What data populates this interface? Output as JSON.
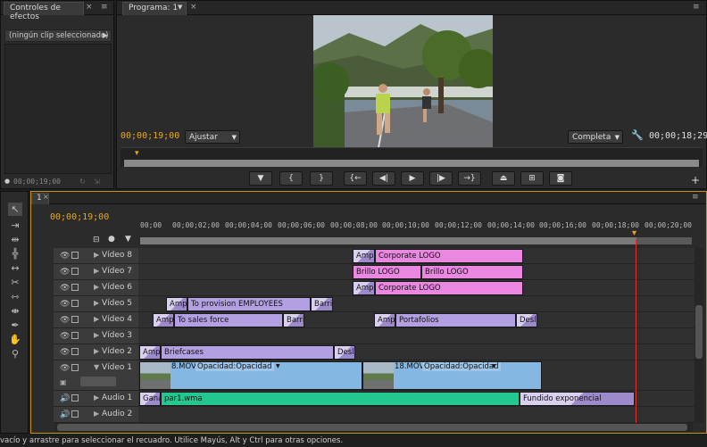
{
  "effects": {
    "tab_label": "Controles de efectos",
    "no_clip": "(ningún clip seleccionado)",
    "timecode": "00;00;19;00"
  },
  "program": {
    "tab_label": "Programa: 1",
    "timecode_current": "00;00;19;00",
    "fit_select": "Ajustar",
    "quality_select": "Completa",
    "timecode_duration": "00;00;18;29"
  },
  "timeline": {
    "tab_label": "1",
    "timecode": "00;00;19;00",
    "ruler": [
      "00;00",
      "00;00;02;00",
      "00;00;04;00",
      "00;00;06;00",
      "00;00;08;00",
      "00;00;10;00",
      "00;00;12;00",
      "00;00;14;00",
      "00;00;16;00",
      "00;00;18;00",
      "00;00;20;00"
    ],
    "tracks": [
      {
        "name": "Vídeo 8"
      },
      {
        "name": "Vídeo 7"
      },
      {
        "name": "Vídeo 6"
      },
      {
        "name": "Vídeo 5"
      },
      {
        "name": "Vídeo 4"
      },
      {
        "name": "Vídeo 3"
      },
      {
        "name": "Vídeo 2"
      },
      {
        "name": "Vídeo 1"
      },
      {
        "name": "Audio 1"
      },
      {
        "name": "Audio 2"
      }
    ],
    "clips": {
      "v8_a": "Ampli",
      "v8_b": "Corporate LOGO",
      "v7_a": "Brillo LOGO",
      "v7_b": "Brillo LOGO",
      "v6_a": "Ampli",
      "v6_b": "Corporate LOGO",
      "v5_a": "Ampli",
      "v5_b": "To provision EMPLOYEES",
      "v5_c": "Barric",
      "v4_a": "Ampli",
      "v4_b": "To sales force",
      "v4_c": "Barri",
      "v4_d": "Ampli",
      "v4_e": "Portafolios",
      "v4_f": "Desli",
      "v2_a": "Ampli",
      "v2_b": "Briefcases",
      "v2_c": "Desliz",
      "v1_a": "8.MOV",
      "v1_a_fx": "Opacidad:Opacidad",
      "v1_b": "18.MOV",
      "v1_b_fx": "Opacidad:Opacidad",
      "a1_a": "Gana",
      "a1_b": "par1.wma",
      "a1_c": "Fundido exponencial"
    }
  },
  "status_bar": "vacío y arrastre para seleccionar el recuadro. Utilice Mayús, Alt y Ctrl para otras opciones.",
  "colors": {
    "timecode": "#e9a91b",
    "playhead": "#e03030",
    "title_clip": "#e987e1",
    "video_clip": "#b3a0e3",
    "audio_clip": "#25c790",
    "movie_clip": "#84b8e2"
  }
}
